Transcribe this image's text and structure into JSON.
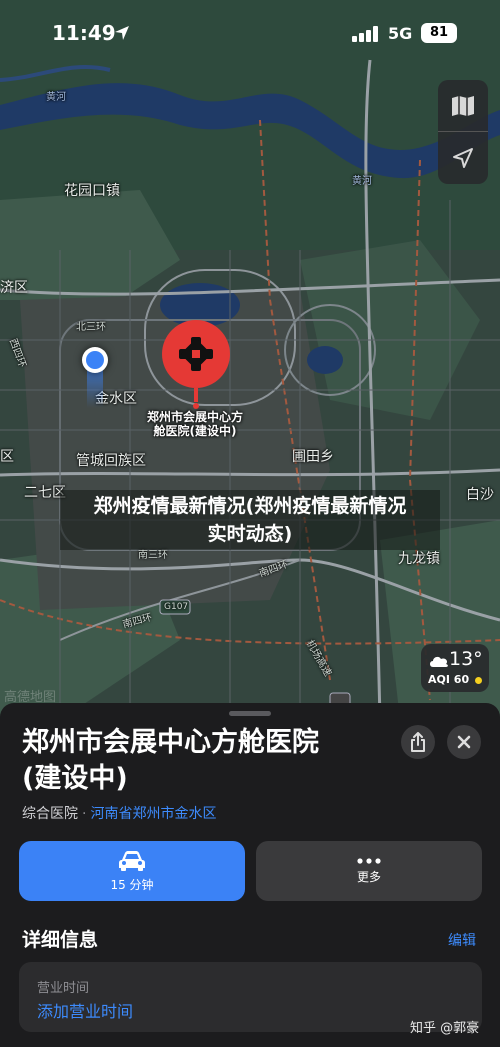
{
  "status_bar": {
    "time": "11:49",
    "network": "5G",
    "battery": "81"
  },
  "map": {
    "labels": {
      "river_n": "黄河",
      "river_e": "黄河",
      "huayuankou": "花园口镇",
      "jiqu": "济区",
      "beisanhuan": "北三环",
      "xisihuan": "西四环",
      "jinshuiqu": "金水区",
      "guancheng": "管城回族区",
      "putianxiang": "圃田乡",
      "erqiqu": "二七区",
      "baisha": "白沙",
      "nansanhuan": "南三环",
      "nansihuan": "南四环",
      "g107": "G107",
      "nansihuan_e": "南四环",
      "jichanggaosu": "机场高速",
      "jiulong": "九龙镇",
      "ciluqu": "区"
    },
    "pin_label_line1": "郑州市会展中心方",
    "pin_label_line2": "舱医院(建设中)",
    "overlay_caption_line1": "郑州疫情最新情况(郑州疫情最新情况",
    "overlay_caption_line2": "实时动态)",
    "watermark": "高德地图"
  },
  "weather": {
    "temp": "13°",
    "aqi": "AQI 60"
  },
  "place": {
    "title_line1": "郑州市会展中心方舱医院",
    "title_line2": "(建设中)",
    "category": "综合医院",
    "separator": "·",
    "location": "河南省郑州市金水区"
  },
  "actions": {
    "drive_label": "15 分钟",
    "more_label": "更多"
  },
  "details": {
    "section_title": "详细信息",
    "edit_label": "编辑",
    "hours_key": "营业时间",
    "hours_value": "添加营业时间"
  },
  "footer_watermark": "知乎 @郭豪",
  "colors": {
    "accent": "#3b82f6",
    "pin": "#e53935",
    "sheet": "#1c1c1e"
  }
}
